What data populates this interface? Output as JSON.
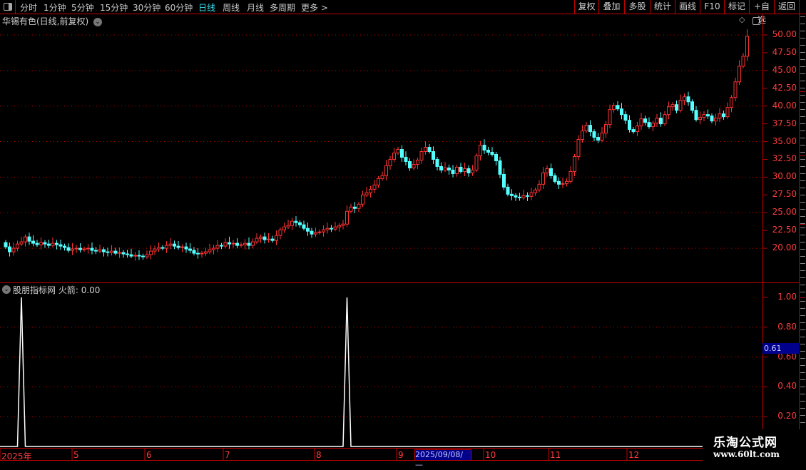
{
  "toolbar": {
    "periods": [
      "分时",
      "1分钟",
      "5分钟",
      "15分钟",
      "30分钟",
      "60分钟",
      "日线",
      "周线",
      "月线",
      "多周期",
      "更多 >"
    ],
    "active_period": "日线",
    "buttons": [
      "复权",
      "叠加",
      "多股",
      "统计",
      "画线",
      "F10",
      "标记",
      "+自选",
      "返回"
    ]
  },
  "chart": {
    "title": "华锡有色(日线,前复权)",
    "price_axis": [
      "50.00",
      "47.50",
      "45.00",
      "42.50",
      "40.00",
      "37.50",
      "35.00",
      "32.50",
      "30.00",
      "27.50",
      "25.00",
      "22.50",
      "20.00"
    ],
    "colors": {
      "up": "#ff3232",
      "down": "#54ffff",
      "grid": "#c00000",
      "axis_text": "#ff3c3c"
    },
    "closes": [
      20.2,
      19.5,
      20.0,
      20.6,
      20.9,
      21.6,
      21.0,
      20.7,
      20.5,
      20.8,
      20.6,
      20.4,
      20.7,
      20.5,
      20.3,
      20.1,
      19.7,
      19.9,
      20.0,
      19.8,
      19.9,
      20.0,
      19.7,
      19.6,
      19.8,
      19.5,
      19.4,
      19.6,
      19.3,
      19.4,
      19.2,
      19.1,
      18.9,
      19.0,
      18.9,
      18.8,
      19.1,
      19.6,
      19.9,
      20.1,
      20.0,
      20.4,
      20.6,
      20.3,
      20.1,
      20.2,
      19.9,
      19.7,
      19.3,
      19.2,
      19.3,
      19.5,
      19.8,
      20.0,
      20.4,
      20.3,
      20.8,
      20.6,
      20.7,
      20.4,
      20.5,
      20.7,
      20.4,
      20.9,
      21.4,
      21.6,
      21.2,
      21.3,
      21.1,
      21.8,
      22.6,
      23.0,
      23.2,
      23.8,
      23.6,
      23.3,
      22.8,
      22.4,
      22.0,
      22.2,
      22.3,
      22.6,
      22.8,
      22.7,
      23.0,
      23.2,
      23.4,
      25.2,
      25.8,
      25.6,
      26.2,
      27.5,
      27.8,
      28.3,
      28.9,
      29.8,
      30.2,
      31.6,
      32.5,
      33.4,
      33.9,
      32.8,
      32.2,
      31.3,
      31.8,
      32.4,
      33.6,
      34.2,
      33.6,
      32.5,
      31.5,
      31.0,
      31.3,
      31.0,
      30.5,
      31.4,
      30.8,
      31.2,
      30.6,
      31.0,
      33.0,
      34.5,
      33.8,
      33.5,
      33.2,
      32.3,
      30.4,
      28.6,
      27.6,
      27.4,
      27.2,
      27.1,
      27.4,
      27.3,
      27.8,
      28.2,
      29.0,
      30.6,
      31.2,
      30.2,
      29.4,
      29.0,
      29.1,
      29.4,
      30.8,
      32.9,
      35.3,
      36.5,
      37.3,
      36.4,
      35.6,
      35.2,
      36.2,
      37.4,
      39.5,
      40.1,
      39.6,
      38.8,
      38.0,
      36.7,
      36.4,
      37.2,
      38.2,
      37.7,
      37.1,
      37.6,
      38.3,
      37.5,
      38.8,
      39.9,
      40.2,
      39.4,
      40.8,
      41.3,
      40.6,
      39.4,
      38.1,
      38.4,
      38.8,
      38.6,
      37.9,
      38.3,
      38.9,
      38.5,
      39.8,
      41.2,
      43.4,
      45.6,
      47.0,
      49.8
    ],
    "first_open": 20.8,
    "last_high": 50.8
  },
  "indicator": {
    "name": "股朋指标网",
    "label": "火箭: 0.00",
    "axis": [
      "1.00",
      "0.80",
      "0.60",
      "0.40",
      "0.20"
    ],
    "signal_points": [
      {
        "index": 4,
        "value": 1
      },
      {
        "index": 87,
        "value": 1
      }
    ],
    "cursor_value": "0.61"
  },
  "x_axis": {
    "labels": [
      "2025年",
      "5",
      "6",
      "7",
      "8",
      "9",
      "10",
      "11",
      "12"
    ],
    "cursor_date": "2025/09/08/—"
  },
  "watermark": {
    "title": "乐淘公式网",
    "url": "www.60lt.com"
  }
}
